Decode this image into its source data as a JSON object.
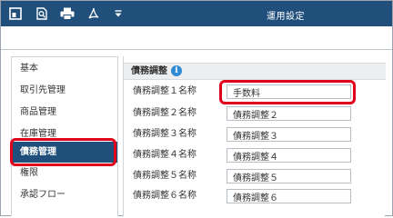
{
  "window": {
    "title": "運用設定"
  },
  "toolbar": {
    "icons": [
      "home-icon",
      "search-doc-icon",
      "print-icon",
      "pdf-export-icon",
      "dropdown-caret-icon"
    ]
  },
  "sidebar": {
    "items": [
      {
        "label": "基本"
      },
      {
        "label": "取引先管理"
      },
      {
        "label": "商品管理"
      },
      {
        "label": "在庫管理"
      },
      {
        "label": "債務管理",
        "active": true
      },
      {
        "label": "権限"
      },
      {
        "label": "承認フロー"
      }
    ]
  },
  "section": {
    "title": "債務調整",
    "info_icon": "info-icon"
  },
  "fields": [
    {
      "label": "債務調整１名称",
      "value": "手数料"
    },
    {
      "label": "債務調整２名称",
      "value": "債務調整２"
    },
    {
      "label": "債務調整３名称",
      "value": "債務調整３"
    },
    {
      "label": "債務調整４名称",
      "value": "債務調整４"
    },
    {
      "label": "債務調整５名称",
      "value": "債務調整５"
    },
    {
      "label": "債務調整６名称",
      "value": "債務調整６"
    }
  ],
  "colors": {
    "titlebar": "#1f4f7a",
    "highlight": "#e0001b",
    "accent": "#2f8ad3"
  }
}
